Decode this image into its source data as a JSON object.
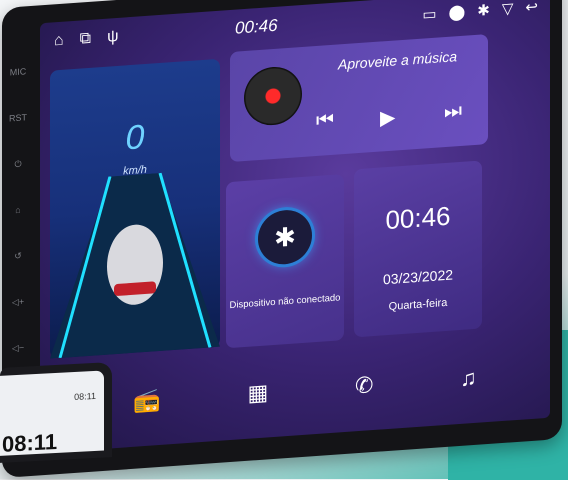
{
  "status_bar": {
    "time": "00:46",
    "left_icons": [
      "home-icon",
      "recent-apps-icon",
      "usb-icon"
    ],
    "right_icons": [
      "cast-icon",
      "location-icon",
      "bluetooth-icon",
      "wifi-icon",
      "back-icon"
    ]
  },
  "speedometer": {
    "value": "0",
    "unit": "km/h"
  },
  "music": {
    "title": "Aproveite a música",
    "controls": [
      "previous-icon",
      "play-icon",
      "next-icon"
    ]
  },
  "bluetooth": {
    "label": "Dispositivo não conectado"
  },
  "clock": {
    "time": "00:46",
    "date": "03/23/2022",
    "weekday": "Quarta-feira"
  },
  "dock": [
    "radio-icon",
    "apps-icon",
    "phone-icon",
    "music-note-icon"
  ],
  "phone_preview": {
    "status_time": "08:11",
    "time": "08:11"
  },
  "colors": {
    "accent": "#5a3b9d",
    "speed": "#6fd2ff",
    "teal": "#2fb3a6"
  }
}
